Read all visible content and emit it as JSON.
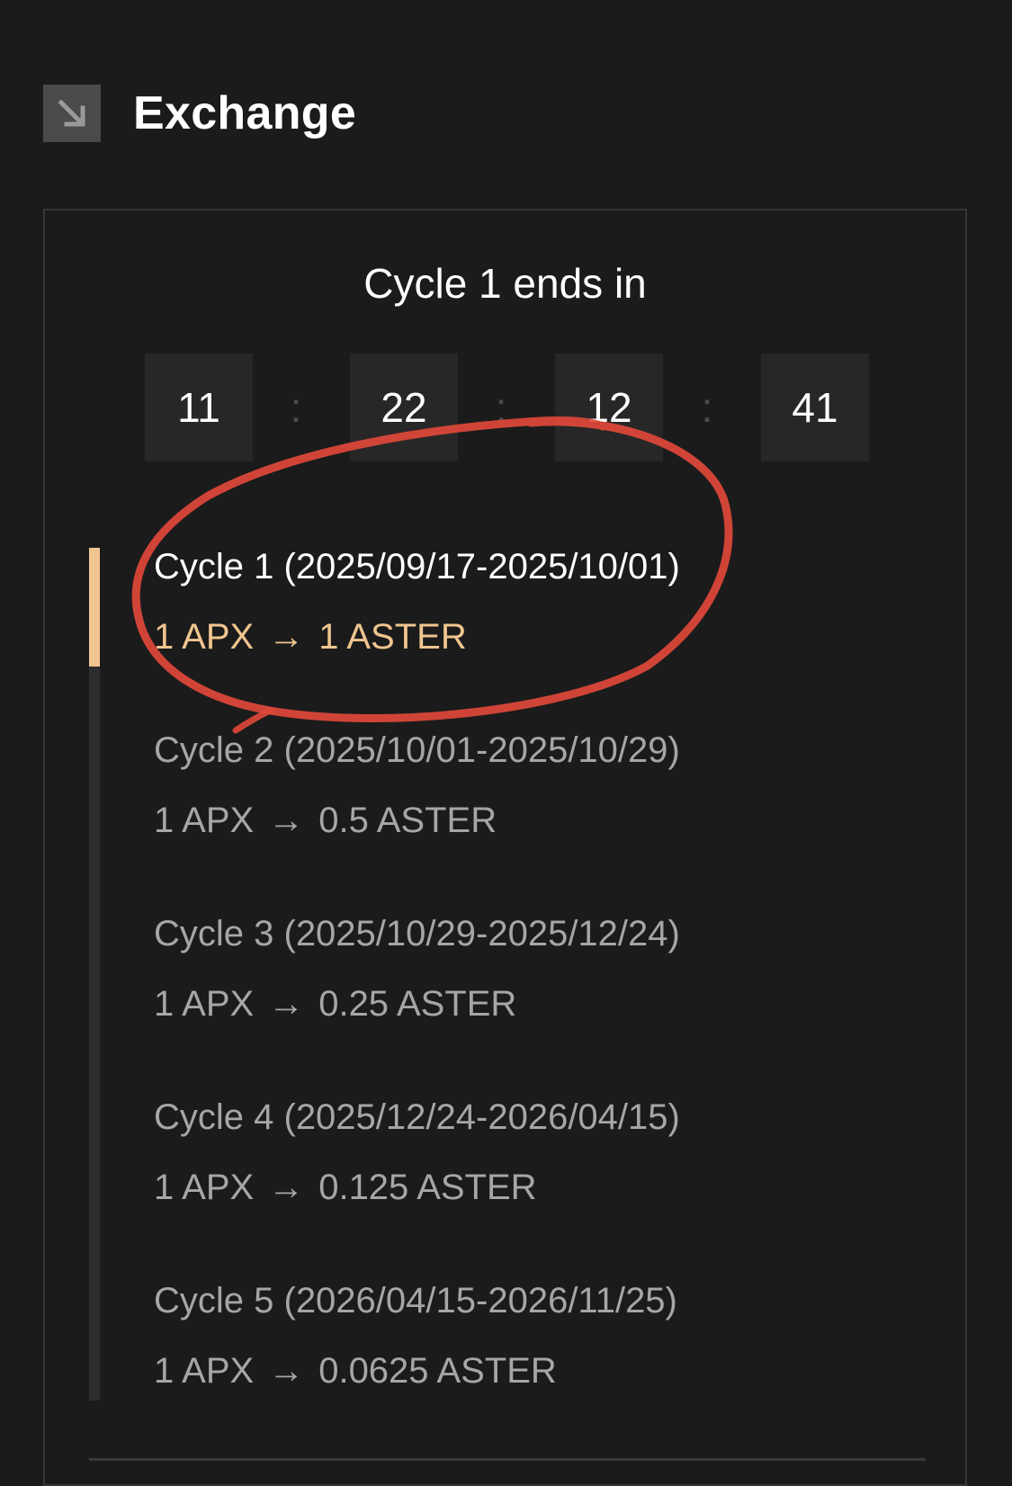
{
  "header": {
    "icon": "arrow-down-right-icon",
    "title": "Exchange"
  },
  "countdown": {
    "label": "Cycle 1 ends in",
    "values": [
      "11",
      "22",
      "12",
      "41"
    ],
    "separator": ":"
  },
  "cycles": [
    {
      "title": "Cycle 1 (2025/09/17-2025/10/01)",
      "from": "1 APX",
      "arrow": "→",
      "to": "1 ASTER",
      "active": true
    },
    {
      "title": "Cycle 2 (2025/10/01-2025/10/29)",
      "from": "1 APX",
      "arrow": "→",
      "to": "0.5 ASTER",
      "active": false
    },
    {
      "title": "Cycle 3 (2025/10/29-2025/12/24)",
      "from": "1 APX",
      "arrow": "→",
      "to": "0.25 ASTER",
      "active": false
    },
    {
      "title": "Cycle 4 (2025/12/24-2026/04/15)",
      "from": "1 APX",
      "arrow": "→",
      "to": "0.125 ASTER",
      "active": false
    },
    {
      "title": "Cycle 5 (2026/04/15-2026/11/25)",
      "from": "1 APX",
      "arrow": "→",
      "to": "0.0625 ASTER",
      "active": false
    }
  ],
  "colors": {
    "background": "#1b1b1b",
    "accent": "#f0c58f",
    "inactive_text": "#a6a6a6",
    "annotation": "#e0483a"
  },
  "annotation": {
    "type": "hand-drawn-circle",
    "target": "cycle-1"
  }
}
